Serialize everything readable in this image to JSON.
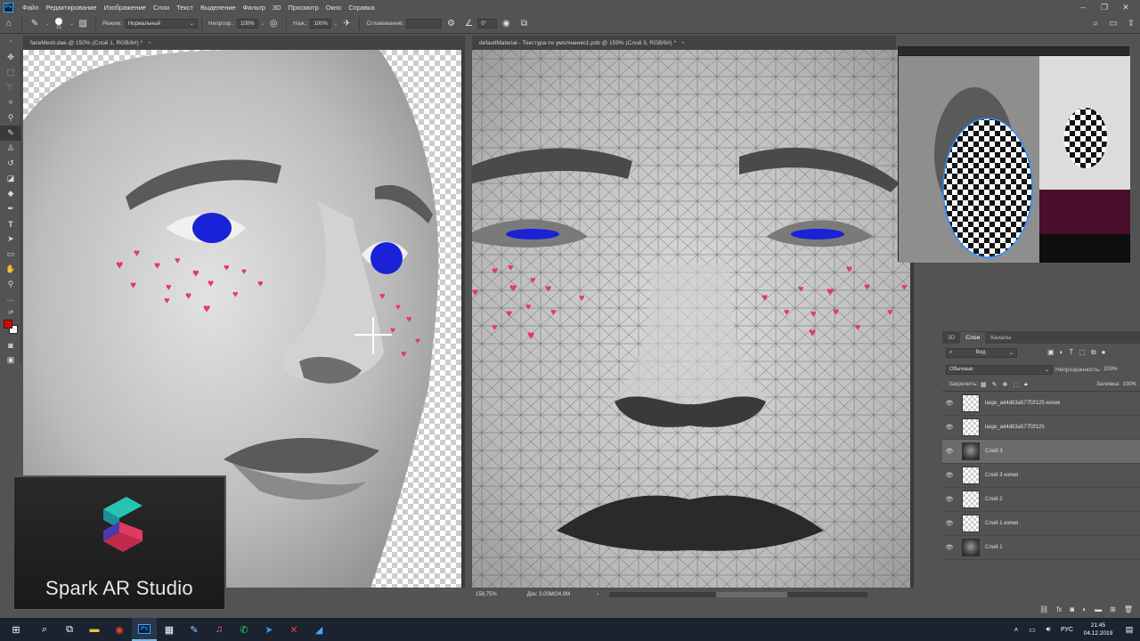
{
  "menubar": {
    "items": [
      "Файл",
      "Редактирование",
      "Изображение",
      "Слои",
      "Текст",
      "Выделение",
      "Фильтр",
      "3D",
      "Просмотр",
      "Окно",
      "Справка"
    ]
  },
  "options": {
    "brush_size": "21",
    "mode_label": "Режим:",
    "mode_value": "Нормальный",
    "opacity_label": "Непрозр.:",
    "opacity_value": "100%",
    "pressure_label": "Наж.:",
    "pressure_value": "100%",
    "smoothing_label": "Сглаживание:",
    "angle_value": "0°"
  },
  "documents": {
    "left_tab": "faceMesh.dae @ 150% (Слой 1, RGB/8#) *",
    "right_tab": "defaultMaterial - Текстура по умолчанию1.psb @ 159% (Слой 3, RGB/8#) *",
    "zoom": "158,75%",
    "doc_size": "Док: 3,00M/24,0M"
  },
  "layers_panel": {
    "tabs": [
      "3D",
      "Слои",
      "Каналы"
    ],
    "active_tab": "Слои",
    "filter_label": "Вид",
    "blend_mode": "Обычные",
    "opacity_label": "Непрозрачность:",
    "opacity_value": "100%",
    "lock_label": "Закрепить:",
    "fill_label": "Заливка:",
    "fill_value": "100%",
    "layers": [
      {
        "name": "large_ad4d03a577f2f125 копия",
        "thumb": "checker",
        "selected": false
      },
      {
        "name": "large_ad4d03a577f2f125",
        "thumb": "checker",
        "selected": false
      },
      {
        "name": "Слой 3",
        "thumb": "face",
        "selected": true
      },
      {
        "name": "Слой 3 копия",
        "thumb": "checker",
        "selected": false
      },
      {
        "name": "Слой 2",
        "thumb": "checker",
        "selected": false
      },
      {
        "name": "Слой 1 копия",
        "thumb": "checker",
        "selected": false
      },
      {
        "name": "Слой 1",
        "thumb": "face",
        "selected": false
      }
    ]
  },
  "overlay": {
    "brand": "Spark AR Studio"
  },
  "taskbar": {
    "lang": "РУС",
    "time": "21:45",
    "date": "04.12.2019"
  },
  "colors": {
    "heart": "#e23a6a",
    "iris": "#1a22d8",
    "fg_color": "#e00000",
    "bg_color": "#ffffff"
  }
}
